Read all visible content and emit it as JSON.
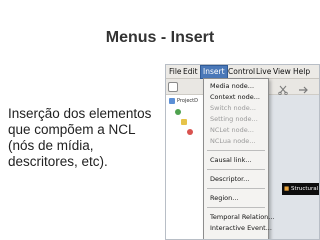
{
  "slide": {
    "title": "Menus - Insert",
    "body": "Inserção dos elementos que compõem a NCL (nós de mídia, descritores, etc)."
  },
  "app": {
    "menubar": {
      "items": [
        {
          "label": "File"
        },
        {
          "label": "Edit"
        },
        {
          "label": "Insert"
        },
        {
          "label": "Control"
        },
        {
          "label": "Live"
        },
        {
          "label": "View"
        },
        {
          "label": "Help"
        }
      ],
      "active_index": 2
    },
    "tree": {
      "root_label": "ProjectD"
    },
    "insert_menu": {
      "items": [
        {
          "label": "Media node...",
          "disabled": false
        },
        {
          "label": "Context node...",
          "disabled": false
        },
        {
          "label": "Switch node...",
          "disabled": true
        },
        {
          "label": "Setting node...",
          "disabled": true
        },
        {
          "label": "NCLet node...",
          "disabled": true
        },
        {
          "label": "NCLua node...",
          "disabled": true
        },
        {
          "label": "Causal link...",
          "disabled": false
        },
        {
          "label": "Descriptor...",
          "disabled": false
        },
        {
          "label": "Region...",
          "disabled": false
        },
        {
          "label": "Temporal Relation...",
          "disabled": false
        },
        {
          "label": "Interactive Event...",
          "disabled": false
        }
      ]
    },
    "structural_tab": {
      "label": "Structural"
    },
    "colors": {
      "menu_highlight": "#4a78b8",
      "structural_tab_bg": "#0d0d0d"
    },
    "toolbar_icons": [
      "page-icon",
      "scissors-icon"
    ]
  }
}
